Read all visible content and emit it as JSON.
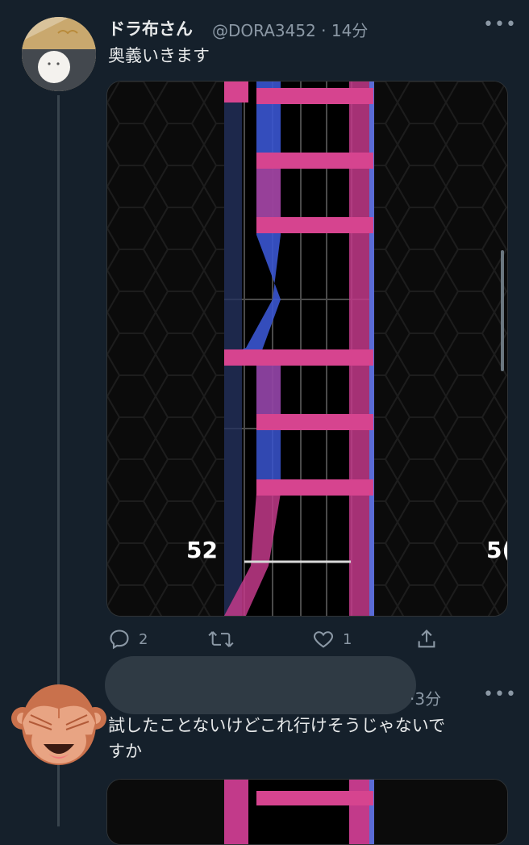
{
  "tweet": {
    "display_name": "ドラ布さん",
    "handle": "@DORA3452",
    "time": "14分",
    "text": "奥義いきます",
    "media_numbers": {
      "left": "52",
      "right": "5("
    },
    "actions": {
      "replies": "2",
      "retweets": "",
      "likes": "1"
    }
  },
  "reply": {
    "time": "3分",
    "text_line1": "試したことないけどこれ行けそうじゃないで",
    "text_line2": "すか"
  },
  "icons": [
    "reply-icon",
    "retweet-icon",
    "like-icon",
    "share-icon",
    "more-icon",
    "see-no-evil-monkey-icon"
  ],
  "colors": {
    "background": "#15202b",
    "text": "#e7e9ea",
    "muted": "#8b98a5",
    "lane_pink": "#d6337f",
    "lane_blue": "#3550c9"
  }
}
